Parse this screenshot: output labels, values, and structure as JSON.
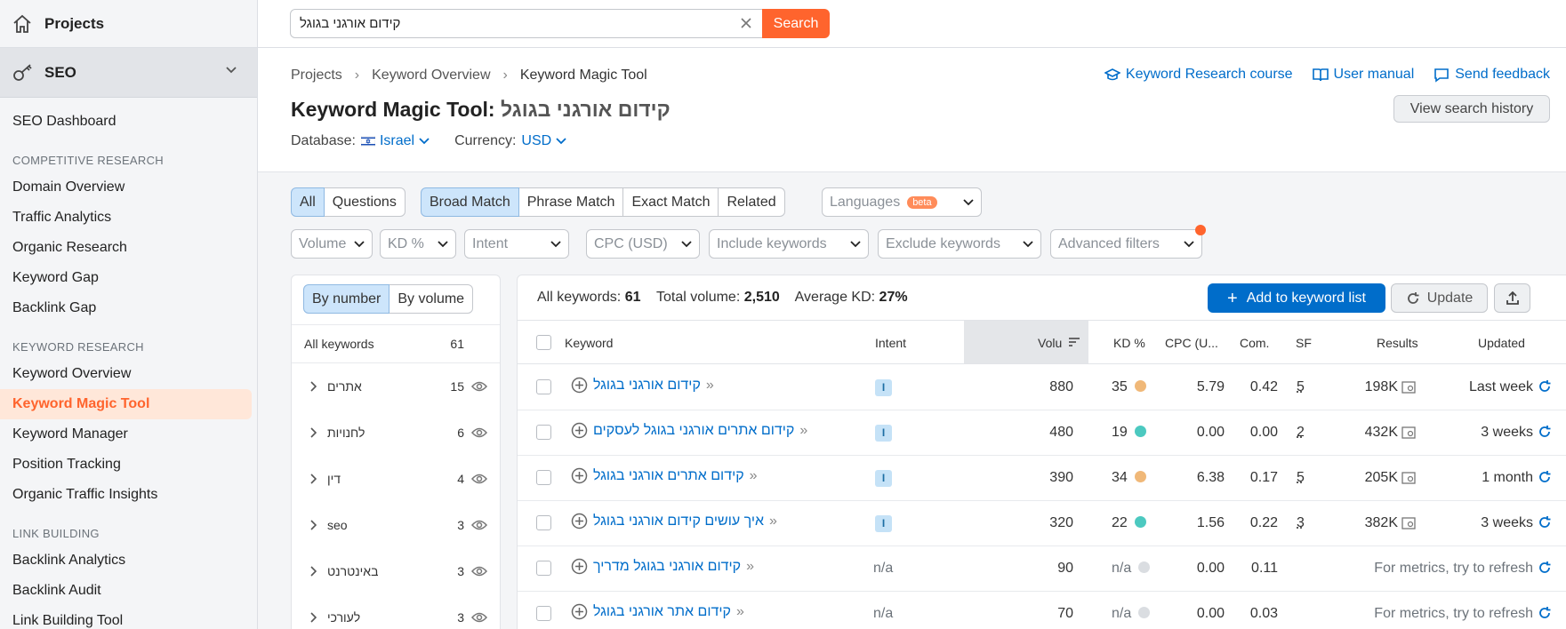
{
  "sidebar": {
    "projects_label": "Projects",
    "seo_label": "SEO",
    "dashboard": "SEO Dashboard",
    "sections": [
      {
        "title": "COMPETITIVE RESEARCH",
        "items": [
          "Domain Overview",
          "Traffic Analytics",
          "Organic Research",
          "Keyword Gap",
          "Backlink Gap"
        ]
      },
      {
        "title": "KEYWORD RESEARCH",
        "items": [
          "Keyword Overview",
          "Keyword Magic Tool",
          "Keyword Manager",
          "Position Tracking",
          "Organic Traffic Insights"
        ]
      },
      {
        "title": "LINK BUILDING",
        "items": [
          "Backlink Analytics",
          "Backlink Audit",
          "Link Building Tool"
        ]
      }
    ],
    "active_item": "Keyword Magic Tool"
  },
  "search": {
    "value": "קידום אורגני בגוגל",
    "button_label": "Search"
  },
  "breadcrumb": [
    "Projects",
    "Keyword Overview",
    "Keyword Magic Tool"
  ],
  "top_links": {
    "course": "Keyword Research course",
    "manual": "User manual",
    "feedback": "Send feedback",
    "history": "View search history"
  },
  "title": {
    "prefix": "Keyword Magic Tool:",
    "query": "קידום אורגני בגוגל"
  },
  "database": {
    "label": "Database:",
    "value": "Israel",
    "currency_label": "Currency:",
    "currency_value": "USD"
  },
  "filters": {
    "type_tabs": [
      "All",
      "Questions"
    ],
    "match_tabs": [
      "Broad Match",
      "Phrase Match",
      "Exact Match",
      "Related"
    ],
    "languages": "Languages",
    "beta": "beta",
    "dropdowns": [
      "Volume",
      "KD %",
      "Intent",
      "CPC (USD)",
      "Include keywords",
      "Exclude keywords",
      "Advanced filters"
    ]
  },
  "groups": {
    "toggle": [
      "By number",
      "By volume"
    ],
    "all_label": "All keywords",
    "all_count": "61",
    "items": [
      {
        "name": "אתרים",
        "count": "15"
      },
      {
        "name": "לחנויות",
        "count": "6"
      },
      {
        "name": "דין",
        "count": "4"
      },
      {
        "name": "seo",
        "count": "3"
      },
      {
        "name": "באינטרנט",
        "count": "3"
      },
      {
        "name": "לעורכי",
        "count": "3"
      }
    ]
  },
  "summary": {
    "all_label": "All keywords:",
    "all_value": "61",
    "volume_label": "Total volume:",
    "volume_value": "2,510",
    "kd_label": "Average KD:",
    "kd_value": "27%"
  },
  "actions": {
    "add": "Add to keyword list",
    "update": "Update"
  },
  "table": {
    "headers": {
      "keyword": "Keyword",
      "intent": "Intent",
      "volume": "Volu",
      "kd": "KD %",
      "cpc": "CPC (U...",
      "com": "Com.",
      "sf": "SF",
      "results": "Results",
      "updated": "Updated"
    },
    "rows": [
      {
        "keyword": "קידום אורגני בגוגל",
        "intent": "I",
        "volume": "880",
        "kd": "35",
        "kd_color": "#f0b878",
        "cpc": "5.79",
        "com": "0.42",
        "sf": "5",
        "results": "198K",
        "updated": "Last week"
      },
      {
        "keyword": "קידום אתרים אורגני בגוגל לעסקים",
        "intent": "I",
        "volume": "480",
        "kd": "19",
        "kd_color": "#4cc9c0",
        "cpc": "0.00",
        "com": "0.00",
        "sf": "2",
        "results": "432K",
        "updated": "3 weeks"
      },
      {
        "keyword": "קידום אתרים אורגני בגוגל",
        "intent": "I",
        "volume": "390",
        "kd": "34",
        "kd_color": "#f0b878",
        "cpc": "6.38",
        "com": "0.17",
        "sf": "5",
        "results": "205K",
        "updated": "1 month"
      },
      {
        "keyword": "איך עושים קידום אורגני בגוגל",
        "intent": "I",
        "volume": "320",
        "kd": "22",
        "kd_color": "#4cc9c0",
        "cpc": "1.56",
        "com": "0.22",
        "sf": "3",
        "results": "382K",
        "updated": "3 weeks"
      },
      {
        "keyword": "קידום אורגני בגוגל מדריך",
        "intent": "n/a",
        "volume": "90",
        "kd": "n/a",
        "kd_color": "#dadde1",
        "cpc": "0.00",
        "com": "0.11",
        "sf": "",
        "results": "",
        "updated": "For metrics, try to refresh"
      },
      {
        "keyword": "קידום אתר אורגני בגוגל",
        "intent": "n/a",
        "volume": "70",
        "kd": "n/a",
        "kd_color": "#dadde1",
        "cpc": "0.00",
        "com": "0.03",
        "sf": "",
        "results": "",
        "updated": "For metrics, try to refresh"
      }
    ]
  },
  "colors": {
    "accent": "#ff642d",
    "link": "#006dca",
    "selected_tab": "#cde5fb"
  }
}
